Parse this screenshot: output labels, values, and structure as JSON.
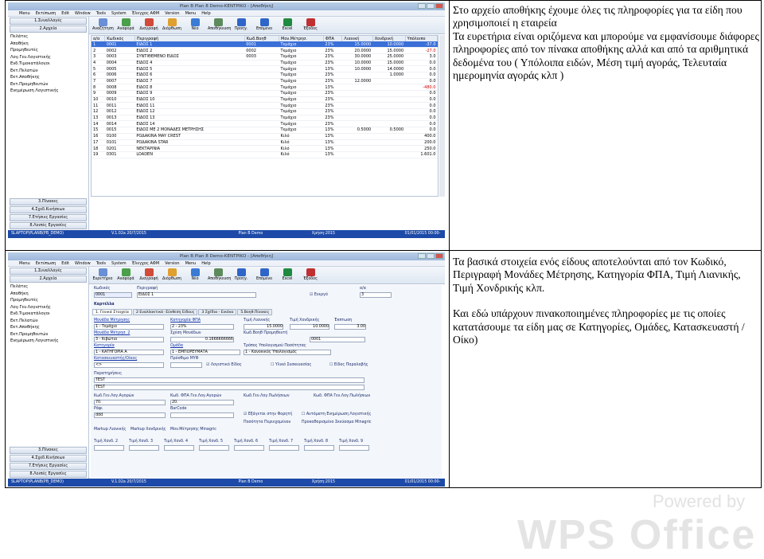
{
  "row1_text": [
    "Στο αρχείο αποθήκης έχουμε όλες τις πληροφορίες για τα είδη που χρησιμοποιεί η εταιρεία",
    "Τα ευρετήρια είναι οριζόμενα και μπορούμε να εμφανίσουμε διάφορες πληροφορίες από τον πίνακα αποθήκης αλλά και από τα αριθμητικά δεδομένα του ( Υπόλοιπα ειδών, Μέση τιμή αγοράς, Τελευταία ημερομηνία αγοράς κλπ )"
  ],
  "row2_text": [
    "Τα βασικά στοιχεία ενός είδους αποτελούνται από τον Κωδικό, Περιγραφή Μονάδες Μέτρησης, Κατηγορία ΦΠΑ, Τιμή Λιανικής, Τιμή Χονδρικής κλπ.",
    "Και εδώ υπάρχουν πινακοποιημένες πληροφορίες με τις οποίες κατατάσουμε τα είδη μας σε Κατηγορίες, Ομάδες, Κατασκευαστή / Οίκο)"
  ],
  "watermark": {
    "powered": "Powered by",
    "brand": "WPS Office"
  },
  "shot1": {
    "title": "Plan B Plan 8 Demo-ΚΕΝΤΡΙΚΟ - [Αποθήκη]",
    "menu": [
      "Menu",
      "Εκτύπωση",
      "Edit",
      "Window",
      "Tools",
      "System",
      "Έλεγχος ΑΦΜ",
      "Version",
      "Menu",
      "Help"
    ],
    "sidebar_top": [
      "1.Συναλλαγές",
      "2.Αρχεία"
    ],
    "sidebar_items": [
      "Πελάτες",
      "Αποθήκη",
      "Προμηθευτές",
      "Λογ.Γεν.Λογιστικής",
      "Ενδ.Τιμοκατάλογοι",
      "Εκτ.Πελατών",
      "Εκτ.Αποθήκης",
      "Εκτ.Προμηθευτών",
      "Ενημέρωση Λογιστικής"
    ],
    "sidebar_bottom": [
      "3.Πίνακες",
      "4.Σχεδ.Κινήσεων",
      "7.Ετήσιες Εργασίες",
      "8.Λοιπές Εργασίες"
    ],
    "toolbar": [
      "Αναζήτηση",
      "Αναφορά",
      "Διαγραφή",
      "Διόρθωση",
      "Νέο",
      "Αποθήκευση",
      "Προηγ.",
      "Επόμενο",
      "Excel",
      "Έξοδος"
    ],
    "tab": "Αποθήκη",
    "columns": [
      "α/α",
      "Κωδικός",
      "Περιγραφή",
      "Κωδ.Βοηθ",
      "Μον.Μέτρησ.",
      "ΦΠΑ",
      "Λιανική",
      "Χονδρική",
      "Υπόλοιπο"
    ],
    "rows": [
      [
        "1",
        "0001",
        "ΕΙΔΟΣ 1",
        "0001",
        "Τεμάχιο",
        "23%",
        "15.0000",
        "10.0000",
        "-37.0"
      ],
      [
        "2",
        "0002",
        "ΕΙΔΟΣ 2",
        "0002",
        "Τεμάχιο",
        "23%",
        "20.0000",
        "15.0000",
        "-27.0"
      ],
      [
        "3",
        "0003",
        "ΣΥΝΤΙΘΕΜΕΝΟ ΕΙΔΟΣ",
        "0003",
        "Τεμάχιο",
        "23%",
        "30.0000",
        "25.0000",
        "3.0"
      ],
      [
        "4",
        "0004",
        "ΕΙΔΟΣ 4",
        "",
        "Τεμάχιο",
        "23%",
        "10.0000",
        "15.0000",
        "0.0"
      ],
      [
        "5",
        "0005",
        "ΕΙΔΟΣ 5",
        "",
        "Τεμάχιο",
        "13%",
        "10.0000",
        "14.0000",
        "0.0"
      ],
      [
        "6",
        "0006",
        "ΕΙΔΟΣ 6",
        "",
        "Τεμάχιο",
        "23%",
        "",
        "1.0000",
        "0.0"
      ],
      [
        "7",
        "0007",
        "ΕΙΔΟΣ 7",
        "",
        "Τεμάχιο",
        "23%",
        "12.0000",
        "",
        "0.0"
      ],
      [
        "8",
        "0008",
        "ΕΙΔΟΣ 8",
        "",
        "Τεμάχιο",
        "13%",
        "",
        "",
        "-480.0"
      ],
      [
        "9",
        "0009",
        "ΕΙΔΟΣ 9",
        "",
        "Τεμάχιο",
        "23%",
        "",
        "",
        "0.0"
      ],
      [
        "10",
        "0010",
        "ΕΙΔΟΣ 10",
        "",
        "Τεμάχιο",
        "23%",
        "",
        "",
        "0.0"
      ],
      [
        "11",
        "0011",
        "ΕΙΔΟΣ 11",
        "",
        "Τεμάχιο",
        "23%",
        "",
        "",
        "0.0"
      ],
      [
        "12",
        "0012",
        "ΕΙΔΟΣ 12",
        "",
        "Τεμάχιο",
        "23%",
        "",
        "",
        "0.0"
      ],
      [
        "13",
        "0013",
        "ΕΙΔΟΣ 13",
        "",
        "Τεμάχιο",
        "23%",
        "",
        "",
        "0.0"
      ],
      [
        "14",
        "0014",
        "ΕΙΔΟΣ 14",
        "",
        "Τεμάχιο",
        "23%",
        "",
        "",
        "0.0"
      ],
      [
        "15",
        "0015",
        "ΕΙΔΟΣ ΜΕ 2 ΜΟΝΑΔΕΣ ΜΕΤΡΗΣΗΣ",
        "",
        "Τεμάχιο",
        "13%",
        "0.5000",
        "0.5000",
        "0.0"
      ],
      [
        "16",
        "0100",
        "ΡΟΔΑΚΙΝΑ MAY CREST",
        "",
        "Κιλό",
        "13%",
        "",
        "",
        "400.0"
      ],
      [
        "17",
        "0101",
        "ΡΟΔΑΚΙΝΑ STAR",
        "",
        "Κιλό",
        "13%",
        "",
        "",
        "200.0"
      ],
      [
        "18",
        "0201",
        "ΝΕΚΤΑΡΙΝΙΑ",
        "",
        "Κιλό",
        "13%",
        "",
        "",
        "250.0"
      ],
      [
        "19",
        "0301",
        "LOADEN",
        "",
        "Κιλό",
        "13%",
        "",
        "",
        "1.601.0"
      ]
    ],
    "status": [
      "SLAPTOP\\PLANB(PB_DEMO)",
      "V.1.02a 20/7/2015 S/N:3010010099911200#@5000@300 HD0C67B7C1",
      "Plan B Demo ΚΕΝΤΡΙΚΟ",
      "Χρήση:2015 26/07/2015 - Χρήστης:USER",
      "01/01/2015 00:00-31/12/2015 23:59"
    ]
  },
  "shot2": {
    "title": "Plan B Plan 8 Demo-ΚΕΝΤΡΙΚΟ - [Αποθήκη]",
    "toolbar": [
      "Ευρετήριο",
      "Αναφορά",
      "Διαγραφή",
      "Διόρθωση",
      "Νέο",
      "Αποθήκευση",
      "Προηγ.",
      "Επόμενο",
      "Excel",
      "Έξοδος"
    ],
    "tab": "Αποθήκη",
    "fields": {
      "code_label": "Κωδικός",
      "code": "0001",
      "desc_label": "Περιγραφή",
      "desc": "ΕΙΔΟΣ 1",
      "active": "Ενεργό",
      "aa_label": "α/α",
      "aa": "3",
      "section": "Καρτέλλα"
    },
    "tabs": [
      "1. Γενικά Στοιχεία",
      "2 Εναλλακτικά -Σύνθεση Είδους",
      "3 Σχέδια - Εικόνα",
      "5.Βοηθ.Πίνακες"
    ],
    "labels": {
      "unit": "Μονάδα Μέτρησης",
      "unit_val": "1 - Τεμάχιο",
      "vat_cat": "Κατηγορία ΦΠΑ",
      "vat_val": "2 - 23%",
      "unit2": "Μονάδα Μέτρησ. 2",
      "unit2_val": "3 - Κιβώτιο",
      "rel": "Σχέση Μονάδων",
      "rel_val": "0.1666666666",
      "retail": "Τιμή Λιανικής",
      "retail_val": "15.0000",
      "whole": "Τιμή Χονδρικής",
      "whole_val": "10.0000",
      "disc": "Έκπτωση",
      "disc_val": "3.00",
      "cat": "Κατηγορία",
      "cat_val": "1 - ΚΑΤΗΓΟΡΙΑ Α",
      "grp": "Ομάδα",
      "grp_val": "1 - ΕΜΠΟΡΕΥΜΑΤΑ",
      "calc": "Τρόπος Υπολογισμού Ποσότητας",
      "calc_val": "1 - Κανονικός Υπολογισμός",
      "maker": "Κατασκευαστής/Οίκος",
      "maker_val": "<>",
      "myf": "Πρόσθιμο ΜΥΦ",
      "myf_val": "",
      "fop": "Λογιστικό Είδος",
      "sym": "Υλικό Συσκευασίας",
      "ltab": "Είδος Παραλαβής",
      "pw": "Κωδ.Βοηθ Προμηθευτή",
      "pw_val": "0001",
      "par": "Παρατηρήσεις",
      "par1": "TEST",
      "par2": "TEST",
      "acc_buy": "Κωδ.Γεν.Λογ.Αγορών",
      "acc_vat_buy": "Κωδ. ΦΠΑ Γεν.Λογ.Αγορών",
      "acc_sell": "Κωδ.Γεν.Λογ.Πωλήσεων",
      "acc_vat_sell": "Κωδ. ΦΠΑ Γεν.Λογ.Πωλήσεων",
      "v70": "70.",
      "v20": "20.",
      "raf": "Ράφι",
      "raf_val": "ddd",
      "barcode": "BarCode",
      "eft": "Εξάγεται στην Φορητή",
      "auto": "Αυτόματη Ενημέρωση Λογιστικής",
      "pp": "Ποσότητα Περιεχομένου",
      "pack": "Προκαθορισμένο Σκεύασμα Minagric",
      "markup_l": "Markup Λιανικής",
      "markup_x": "Markup Χονδρικής",
      "mon_min": "Μον.Μέτρησης Minagric",
      "prices": [
        "Τιμή Χονδ. 2",
        "Τιμή Χονδ. 3",
        "Τιμή Χονδ. 4",
        "Τιμή Χονδ. 5",
        "Τιμή Χονδ. 6",
        "Τιμή Χονδ. 7",
        "Τιμή Χονδ. 8",
        "Τιμή Χονδ. 9"
      ]
    }
  }
}
